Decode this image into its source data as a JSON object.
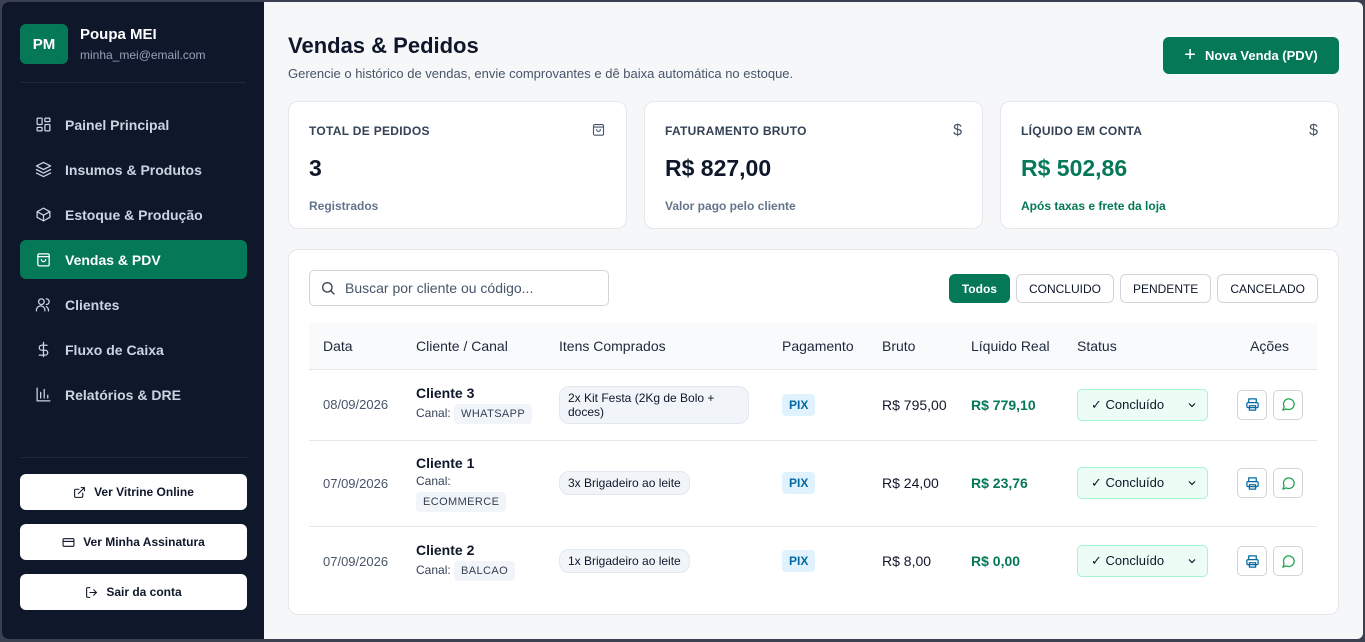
{
  "user": {
    "initials": "PM",
    "name": "Poupa MEI",
    "email": "minha_mei@email.com"
  },
  "nav": [
    {
      "label": "Painel Principal",
      "icon": "grid-icon"
    },
    {
      "label": "Insumos & Produtos",
      "icon": "layers-icon"
    },
    {
      "label": "Estoque & Produção",
      "icon": "box-icon"
    },
    {
      "label": "Vendas & PDV",
      "icon": "shopping-bag-icon",
      "active": true
    },
    {
      "label": "Clientes",
      "icon": "users-icon"
    },
    {
      "label": "Fluxo de Caixa",
      "icon": "dollar-icon"
    },
    {
      "label": "Relatórios & DRE",
      "icon": "bar-chart-icon"
    }
  ],
  "side_buttons": {
    "storefront": "Ver Vitrine Online",
    "subscription": "Ver Minha Assinatura",
    "logout": "Sair da conta"
  },
  "header": {
    "title": "Vendas & Pedidos",
    "subtitle": "Gerencie o histórico de vendas, envie comprovantes e dê baixa automática no estoque.",
    "new_sale": "Nova Venda (PDV)"
  },
  "stats": {
    "orders": {
      "label": "TOTAL DE PEDIDOS",
      "value": "3",
      "note": "Registrados"
    },
    "gross": {
      "label": "FATURAMENTO BRUTO",
      "value": "R$ 827,00",
      "note": "Valor pago pelo cliente"
    },
    "net": {
      "label": "LÍQUIDO EM CONTA",
      "value": "R$ 502,86",
      "note": "Após taxas e frete da loja"
    },
    "currency_symbol": "$"
  },
  "search": {
    "placeholder": "Buscar por cliente ou código..."
  },
  "filters": [
    "Todos",
    "CONCLUIDO",
    "PENDENTE",
    "CANCELADO"
  ],
  "table": {
    "columns": [
      "Data",
      "Cliente / Canal",
      "Itens Comprados",
      "Pagamento",
      "Bruto",
      "Líquido Real",
      "Status",
      "Ações"
    ],
    "canal_label": "Canal:",
    "rows": [
      {
        "date": "08/09/2026",
        "client": "Cliente 3",
        "channel": "WHATSAPP",
        "items": "2x Kit Festa (2Kg de Bolo + doces)",
        "payment": "PIX",
        "gross": "R$ 795,00",
        "net": "R$ 779,10",
        "status": "Concluído"
      },
      {
        "date": "07/09/2026",
        "client": "Cliente 1",
        "channel": "ECOMMERCE",
        "items": "3x Brigadeiro ao leite",
        "payment": "PIX",
        "gross": "R$ 24,00",
        "net": "R$ 23,76",
        "status": "Concluído"
      },
      {
        "date": "07/09/2026",
        "client": "Cliente 2",
        "channel": "BALCAO",
        "items": "1x Brigadeiro ao leite",
        "payment": "PIX",
        "gross": "R$ 8,00",
        "net": "R$ 0,00",
        "status": "Concluído"
      }
    ]
  },
  "colors": {
    "accent": "#047857",
    "sidebar": "#0f172a",
    "background": "#f6f7f9"
  }
}
